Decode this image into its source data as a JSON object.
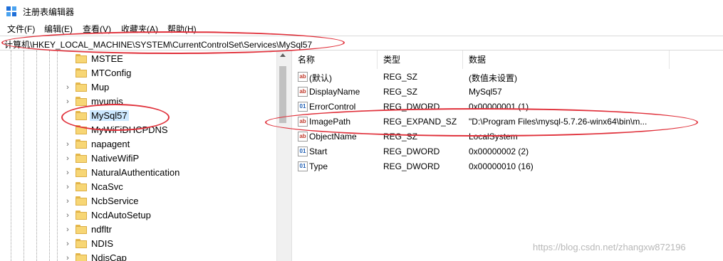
{
  "window": {
    "title": "注册表编辑器"
  },
  "menu": [
    "文件(F)",
    "编辑(E)",
    "查看(V)",
    "收藏夹(A)",
    "帮助(H)"
  ],
  "address": "计算机\\HKEY_LOCAL_MACHINE\\SYSTEM\\CurrentControlSet\\Services\\MySql57",
  "tree": {
    "items": [
      {
        "label": "MSTEE",
        "expandable": false
      },
      {
        "label": "MTConfig",
        "expandable": false
      },
      {
        "label": "Mup",
        "expandable": true
      },
      {
        "label": "mvumis",
        "expandable": true
      },
      {
        "label": "MySql57",
        "expandable": false,
        "selected": true
      },
      {
        "label": "MyWiFiDHCPDNS",
        "expandable": false
      },
      {
        "label": "napagent",
        "expandable": true
      },
      {
        "label": "NativeWifiP",
        "expandable": true
      },
      {
        "label": "NaturalAuthentication",
        "expandable": true
      },
      {
        "label": "NcaSvc",
        "expandable": true
      },
      {
        "label": "NcbService",
        "expandable": true
      },
      {
        "label": "NcdAutoSetup",
        "expandable": true
      },
      {
        "label": "ndfltr",
        "expandable": true
      },
      {
        "label": "NDIS",
        "expandable": true
      },
      {
        "label": "NdisCap",
        "expandable": true
      }
    ]
  },
  "list": {
    "columns": [
      "名称",
      "类型",
      "数据"
    ],
    "rows": [
      {
        "icon": "string-value-icon",
        "name": "(默认)",
        "type": "REG_SZ",
        "data": "(数值未设置)"
      },
      {
        "icon": "string-value-icon",
        "name": "DisplayName",
        "type": "REG_SZ",
        "data": "MySql57"
      },
      {
        "icon": "binary-value-icon",
        "name": "ErrorControl",
        "type": "REG_DWORD",
        "data": "0x00000001 (1)"
      },
      {
        "icon": "string-value-icon",
        "name": "ImagePath",
        "type": "REG_EXPAND_SZ",
        "data": "\"D:\\Program Files\\mysql-5.7.26-winx64\\bin\\m..."
      },
      {
        "icon": "string-value-icon",
        "name": "ObjectName",
        "type": "REG_SZ",
        "data": "LocalSystem"
      },
      {
        "icon": "binary-value-icon",
        "name": "Start",
        "type": "REG_DWORD",
        "data": "0x00000002 (2)"
      },
      {
        "icon": "binary-value-icon",
        "name": "Type",
        "type": "REG_DWORD",
        "data": "0x00000010 (16)"
      }
    ]
  },
  "watermark": "https://blog.csdn.net/zhangxw872196",
  "colors": {
    "highlight": "#e0303a",
    "selection": "#cce8ff",
    "folder": "#f7d675"
  }
}
